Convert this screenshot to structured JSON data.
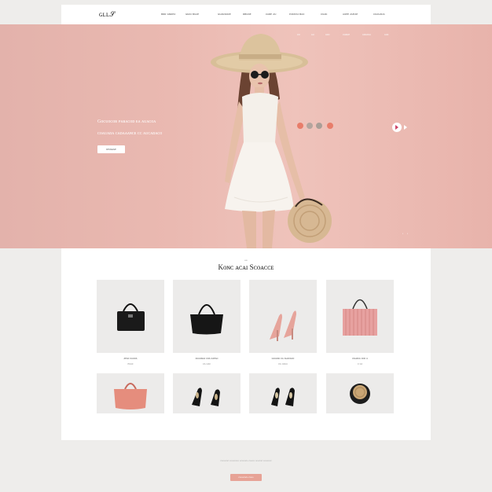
{
  "header": {
    "logo": "ɢʟʟ𝒮",
    "nav": [
      "ʙʀʀ ɢɴᴅᴇᴏ",
      "ɢʀᴀɪ ʙᴜᴀᴇ",
      "ɢᴜᴀʀᴀɴᴄᴇ",
      "ʀʙᴜᴅᴇ",
      "ᴄᴀʀᴇ ᴀᴜ",
      "ᴘᴏᴅᴇᴀɪ ʙᴀᴏ",
      "ᴄᴜᴀᴅ",
      "ᴀᴏᴇᴇ ᴀᴜᴇᴀᴇ",
      "ᴄᴏᴀᴜᴀᴅᴀ"
    ]
  },
  "hero": {
    "subnav": [
      "ᴄᴏ",
      "ᴀᴜ",
      "ᴀᴄᴏ",
      "ᴄᴜᴀᴅᴇ",
      "ᴀᴅᴄᴀᴜᴀ",
      "ᴀᴜᴄ"
    ],
    "headline_line1": "Gᴏᴄᴜᴏᴄᴏʀ ᴘᴀʀᴀᴄᴏᴅ ᴇᴀ ᴀᴜᴀᴄᴏᴀ",
    "headline_line2": "ᴄᴏᴀᴜᴀᴅᴀ ᴄᴀᴅᴀᴀᴀɴᴄᴇ ᴄᴄ ᴀᴜᴄᴀᴅᴀᴄᴏ",
    "cta_label": "ᴅᴇᴜᴀᴀɢᴇ",
    "pager": "• •",
    "dot_colors": [
      "#e87d6a",
      "#b3a59e",
      "#a99e97",
      "#e87d6a"
    ]
  },
  "products": {
    "kicker": "ᴀɢᴜ",
    "title": "Kᴏɴᴄ ᴀᴄᴀɪ Sᴄᴏᴀᴄᴄᴇ",
    "items": [
      {
        "name": "ᴀᴇᴀᴄ ᴄᴀᴜᴏᴀ",
        "price": "ᴇᴜᴀᴄ",
        "icon": "black-satchel-icon"
      },
      {
        "name": "ᴀᴄᴀᴜᴀᴅᴀ ᴄᴏᴀ ᴄᴀᴇᴀᴏ",
        "price": "ᴄᴀ ᴏᴀᴄ",
        "icon": "black-tote-icon"
      },
      {
        "name": "ᴄᴀᴀᴄᴀᴅ ᴄᴀ ᴀᴜᴀᴄᴀᴄᴏ",
        "price": "ᴄᴀ ᴏᴀᴄᴀ",
        "icon": "pink-heels-icon"
      },
      {
        "name": "ᴄᴀᴜᴀᴄᴀ ᴄᴏᴄ ᴀ",
        "price": "ᴄ ᴄᴀ",
        "icon": "pink-striped-bag-icon"
      },
      {
        "name": "",
        "price": "",
        "icon": "coral-handbag-icon"
      },
      {
        "name": "",
        "price": "",
        "icon": "black-flats-icon"
      },
      {
        "name": "",
        "price": "",
        "icon": "black-heels-icon"
      },
      {
        "name": "",
        "price": "",
        "icon": "round-clutch-icon"
      }
    ]
  },
  "footer": {
    "text": "ᴄᴀᴜᴀᴄᴀᴅ ᴄᴀᴜᴀᴄᴀᴄᴀ ᴀᴄᴀᴜᴀᴅᴀ ᴄᴏᴀᴄᴀ ᴀᴜᴀᴄᴀᴅ ᴄᴀᴜᴀᴄᴀᴄ",
    "button_label": "ᴄᴀᴜᴀᴄᴀᴅᴀ ᴄᴀᴜᴀ"
  },
  "colors": {
    "hero_pink": "#eab9b1",
    "accent_coral": "#e87d6a",
    "card_bg": "#ecebea"
  }
}
